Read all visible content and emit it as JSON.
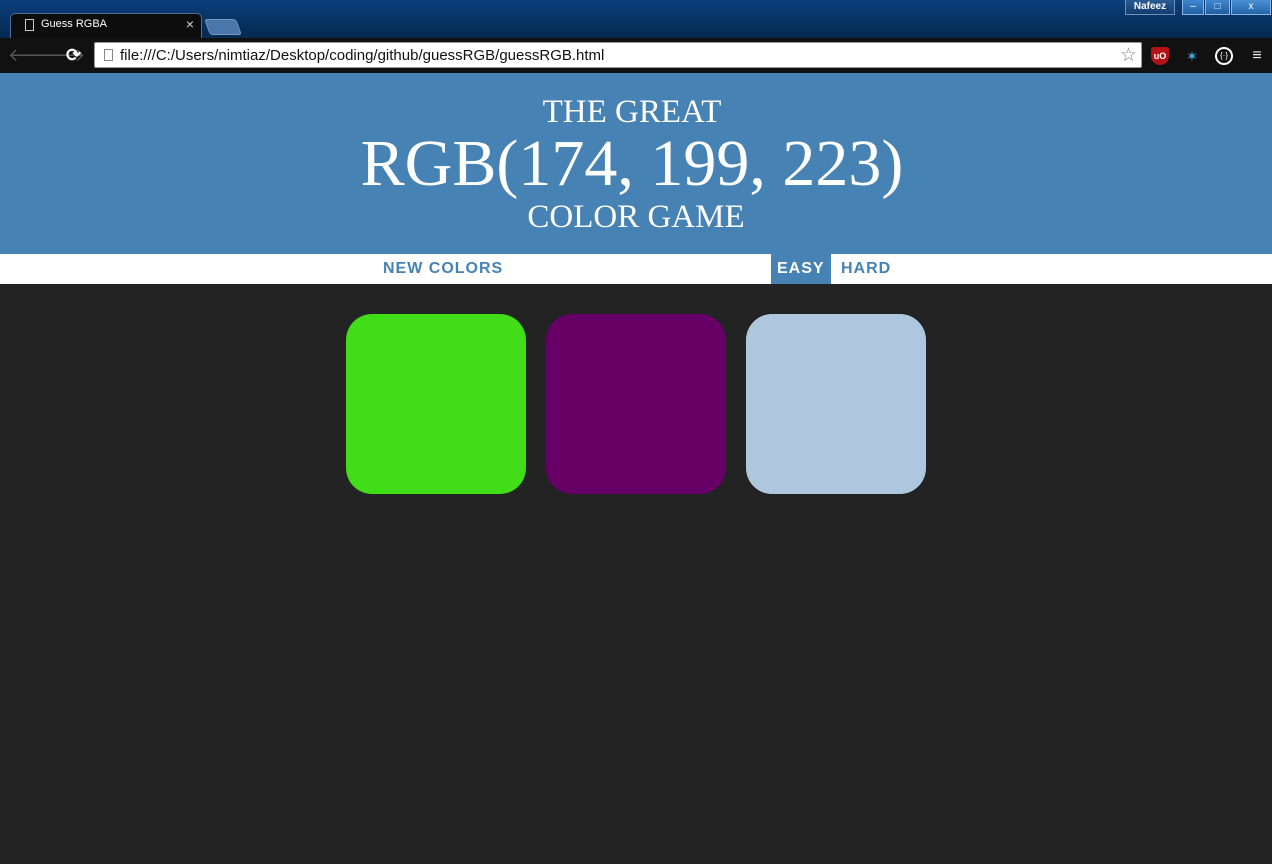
{
  "browser": {
    "tab_title": "Guess RGBA",
    "tab_close": "×",
    "user_name": "Nafeez",
    "window_controls": {
      "minimize": "‒",
      "maximize": "□",
      "close": "x"
    },
    "url": "file:///C:/Users/nimtiaz/Desktop/coding/github/guessRGB/guessRGB.html",
    "nav": {
      "back": "🡐",
      "forward": "🡒",
      "reload": "⟳"
    },
    "star": "☆",
    "extensions": {
      "ublock": "uO",
      "ext3": "{·}",
      "menu": "≡"
    }
  },
  "header": {
    "line1": "THE GREAT",
    "color_display": "RGB(174, 199, 223)",
    "line3": "COLOR GAME",
    "background": "#4682b4"
  },
  "stripe": {
    "new_colors": "NEW COLORS",
    "message": "",
    "easy": "EASY",
    "hard": "HARD",
    "selected_mode": "EASY"
  },
  "squares": [
    {
      "color": "#40dd18"
    },
    {
      "color": "#660066"
    },
    {
      "color": "#aec7df"
    }
  ],
  "page_background": "#232323"
}
